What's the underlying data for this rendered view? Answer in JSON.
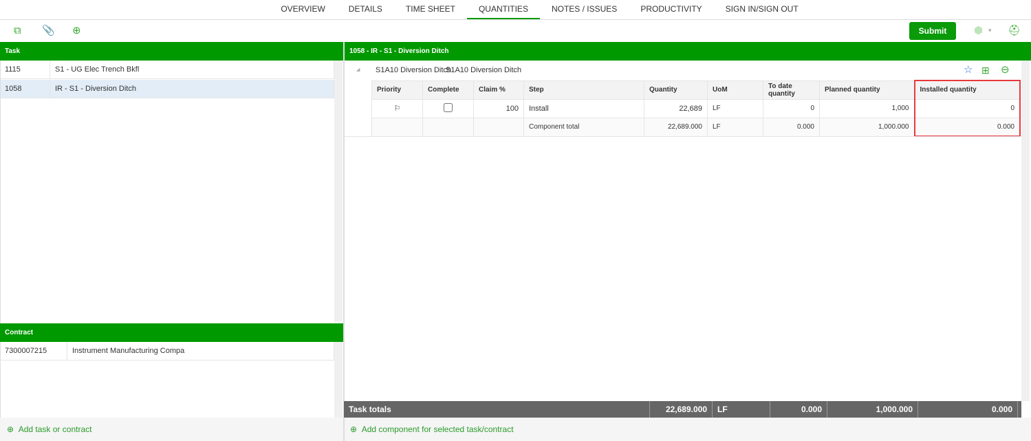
{
  "nav": {
    "tabs": [
      "OVERVIEW",
      "DETAILS",
      "TIME SHEET",
      "QUANTITIES",
      "NOTES / ISSUES",
      "PRODUCTIVITY",
      "SIGN IN/SIGN OUT"
    ]
  },
  "toolbar": {
    "submit": "Submit"
  },
  "task_panel": {
    "header": "Task",
    "rows": [
      {
        "id": "1115",
        "name": "S1 - UG Elec Trench Bkfl"
      },
      {
        "id": "1058",
        "name": "IR - S1 - Diversion Ditch"
      }
    ]
  },
  "contract_panel": {
    "header": "Contract",
    "rows": [
      {
        "id": "7300007215",
        "name": "Instrument Manufacturing Compa"
      }
    ]
  },
  "add_task": "Add task or contract",
  "detail": {
    "header": "1058 - IR - S1 - Diversion Ditch",
    "component_code": "S1A10 Diversion Ditch",
    "component_name": "S1A10 Diversion Ditch",
    "columns": [
      "Priority",
      "Complete",
      "Claim %",
      "Step",
      "Quantity",
      "UoM",
      "To date quantity",
      "Planned quantity",
      "Installed quantity"
    ],
    "row": {
      "claim": "100",
      "step": "Install",
      "quantity": "22,689",
      "uom": "LF",
      "to_date": "0",
      "planned": "1,000",
      "installed": "0"
    },
    "total": {
      "label": "Component total",
      "quantity": "22,689.000",
      "uom": "LF",
      "to_date": "0.000",
      "planned": "1,000.000",
      "installed": "0.000"
    }
  },
  "task_totals": {
    "label": "Task totals",
    "quantity": "22,689.000",
    "uom": "LF",
    "to_date": "0.000",
    "planned": "1,000.000",
    "installed": "0.000"
  },
  "add_component": "Add component for selected task/contract",
  "colors": {
    "accent": "#009900",
    "highlight": "#e8383d"
  }
}
